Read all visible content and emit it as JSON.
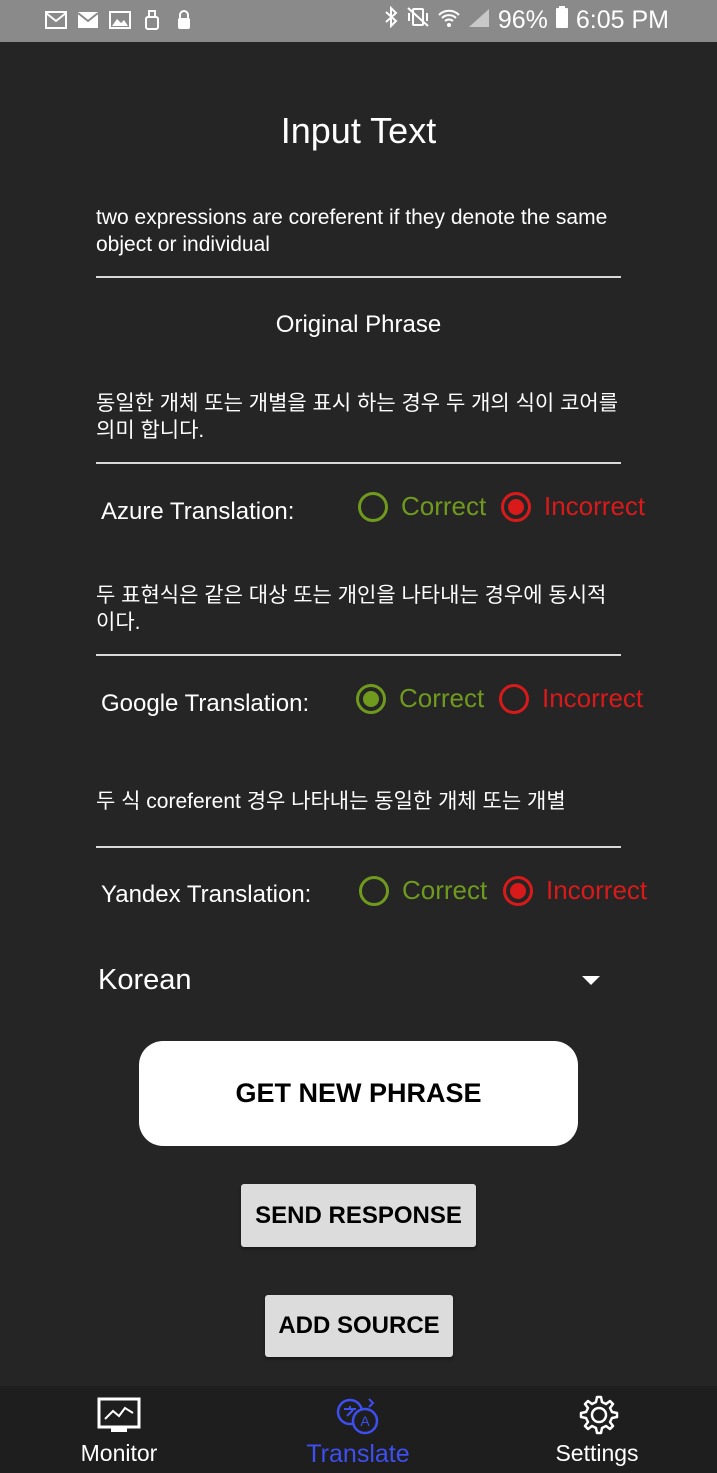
{
  "status_bar": {
    "battery": "96%",
    "time": "6:05 PM"
  },
  "title": "Input Text",
  "input_text": "two expressions are coreferent if they denote the same object or individual",
  "subtitle": "Original Phrase",
  "translations": [
    {
      "text": "동일한 개체 또는 개별을 표시 하는 경우 두 개의 식이 코어를 의미 합니다.",
      "label": "Azure Translation:",
      "selected": "Incorrect"
    },
    {
      "text": "두 표현식은 같은 대상 또는 개인을 나타내는 경우에 동시적이다.",
      "label": "Google Translation:",
      "selected": "Correct"
    },
    {
      "text": "두 식 coreferent 경우 나타내는 동일한 개체 또는 개별",
      "label": "Yandex Translation:",
      "selected": "Incorrect"
    }
  ],
  "options": {
    "correct": "Correct",
    "incorrect": "Incorrect"
  },
  "language_select": {
    "value": "Korean"
  },
  "buttons": {
    "get_new_phrase": "GET NEW PHRASE",
    "send_response": "SEND RESPONSE",
    "add_source": "ADD SOURCE"
  },
  "nav": {
    "monitor": "Monitor",
    "translate": "Translate",
    "settings": "Settings",
    "active": "translate"
  },
  "colors": {
    "correct": "#6f9a1e",
    "incorrect": "#d91a1a",
    "nav_active": "#3d4ff0",
    "background": "#252525"
  }
}
